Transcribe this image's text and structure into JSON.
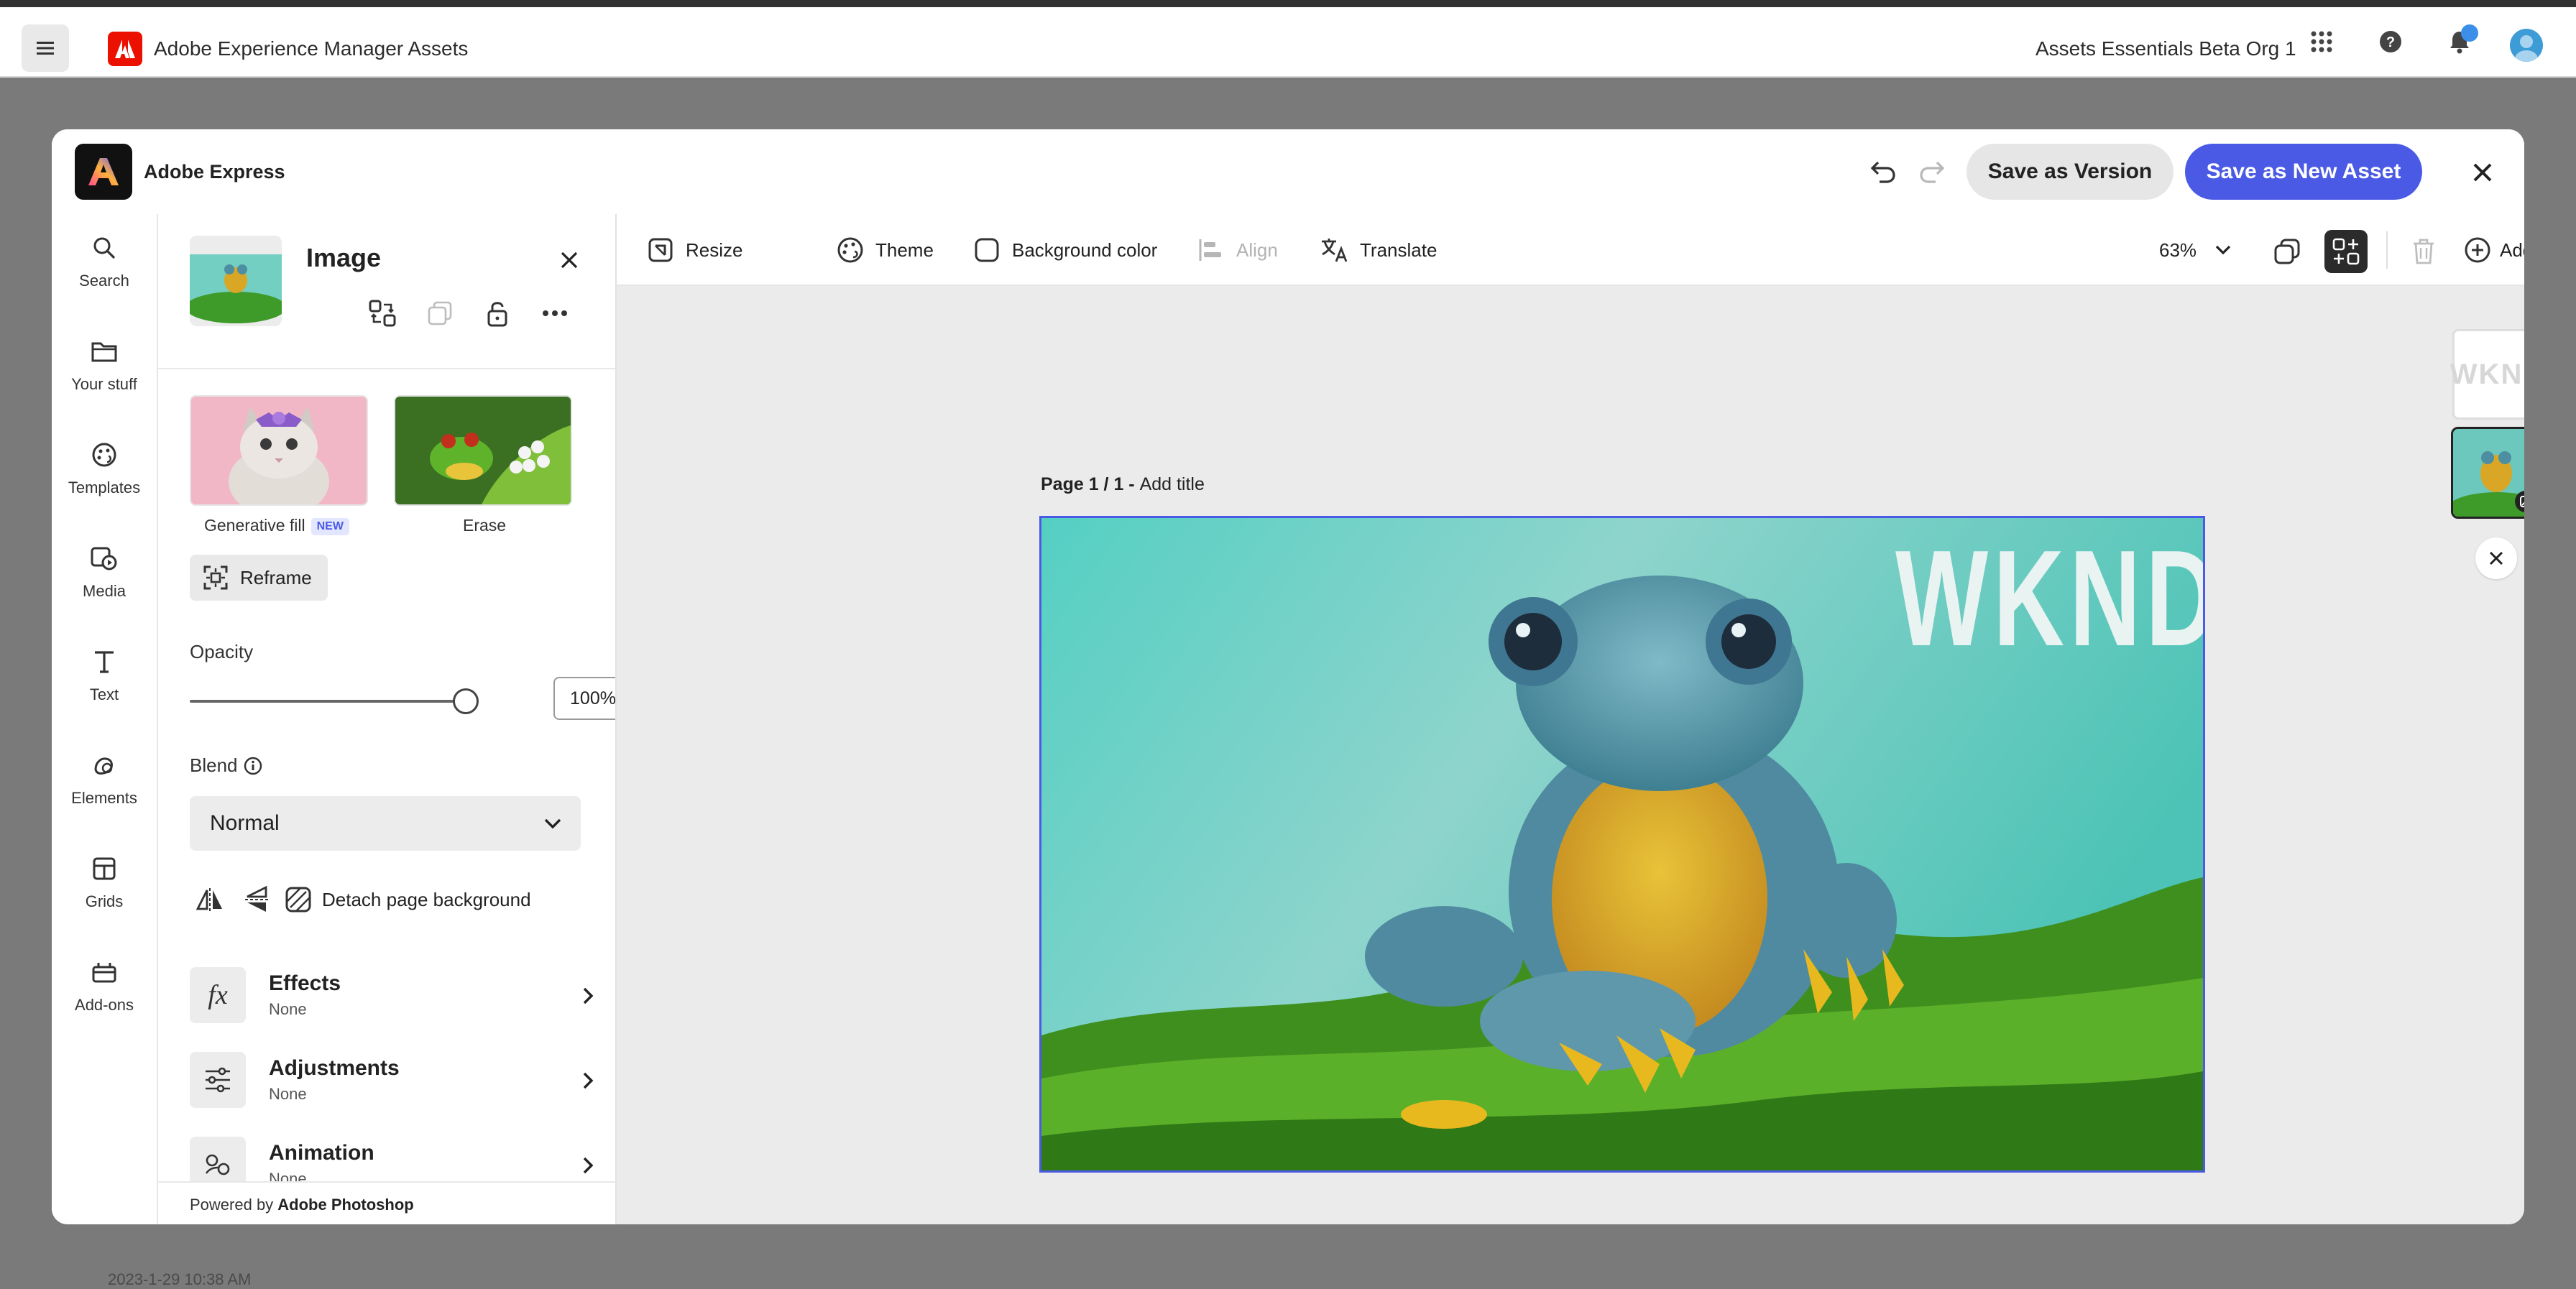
{
  "aem": {
    "title": "Adobe Experience Manager Assets",
    "org": "Assets Essentials Beta Org 1"
  },
  "modal": {
    "title": "Adobe Express",
    "save_version": "Save as Version",
    "save_new": "Save as New Asset"
  },
  "rail": {
    "items": [
      {
        "label": "Search",
        "icon": "search-icon"
      },
      {
        "label": "Your stuff",
        "icon": "folder-icon"
      },
      {
        "label": "Templates",
        "icon": "templates-icon"
      },
      {
        "label": "Media",
        "icon": "media-icon"
      },
      {
        "label": "Text",
        "icon": "text-icon"
      },
      {
        "label": "Elements",
        "icon": "elements-icon"
      },
      {
        "label": "Grids",
        "icon": "grids-icon"
      },
      {
        "label": "Add-ons",
        "icon": "addons-icon"
      }
    ]
  },
  "panel": {
    "title": "Image",
    "generative_fill": "Generative fill",
    "new_badge": "NEW",
    "erase": "Erase",
    "reframe": "Reframe",
    "opacity_label": "Opacity",
    "opacity_value": "100%",
    "opacity_level": 1.0,
    "blend_label": "Blend",
    "blend_value": "Normal",
    "detach": "Detach page background",
    "accordions": [
      {
        "title": "Effects",
        "sub": "None",
        "icon": "fx-icon"
      },
      {
        "title": "Adjustments",
        "sub": "None",
        "icon": "sliders-icon"
      },
      {
        "title": "Animation",
        "sub": "None",
        "icon": "animation-icon"
      }
    ],
    "powered_prefix": "Powered by ",
    "powered_brand": "Adobe Photoshop"
  },
  "toolbar": {
    "resize": "Resize",
    "theme": "Theme",
    "background_color": "Background color",
    "align": "Align",
    "translate": "Translate",
    "zoom": "63%",
    "add": "Add"
  },
  "canvas": {
    "page_label": "Page 1 / 1 - ",
    "add_title": "Add title",
    "overlay_text": "WKND",
    "thumb_text": "WKND"
  },
  "colors": {
    "accent": "#4b5ae5",
    "adobe_red": "#eb1000",
    "teal_bg": "#6cc8bd"
  },
  "bottom_hint": "2023-1-29 10:38 AM"
}
